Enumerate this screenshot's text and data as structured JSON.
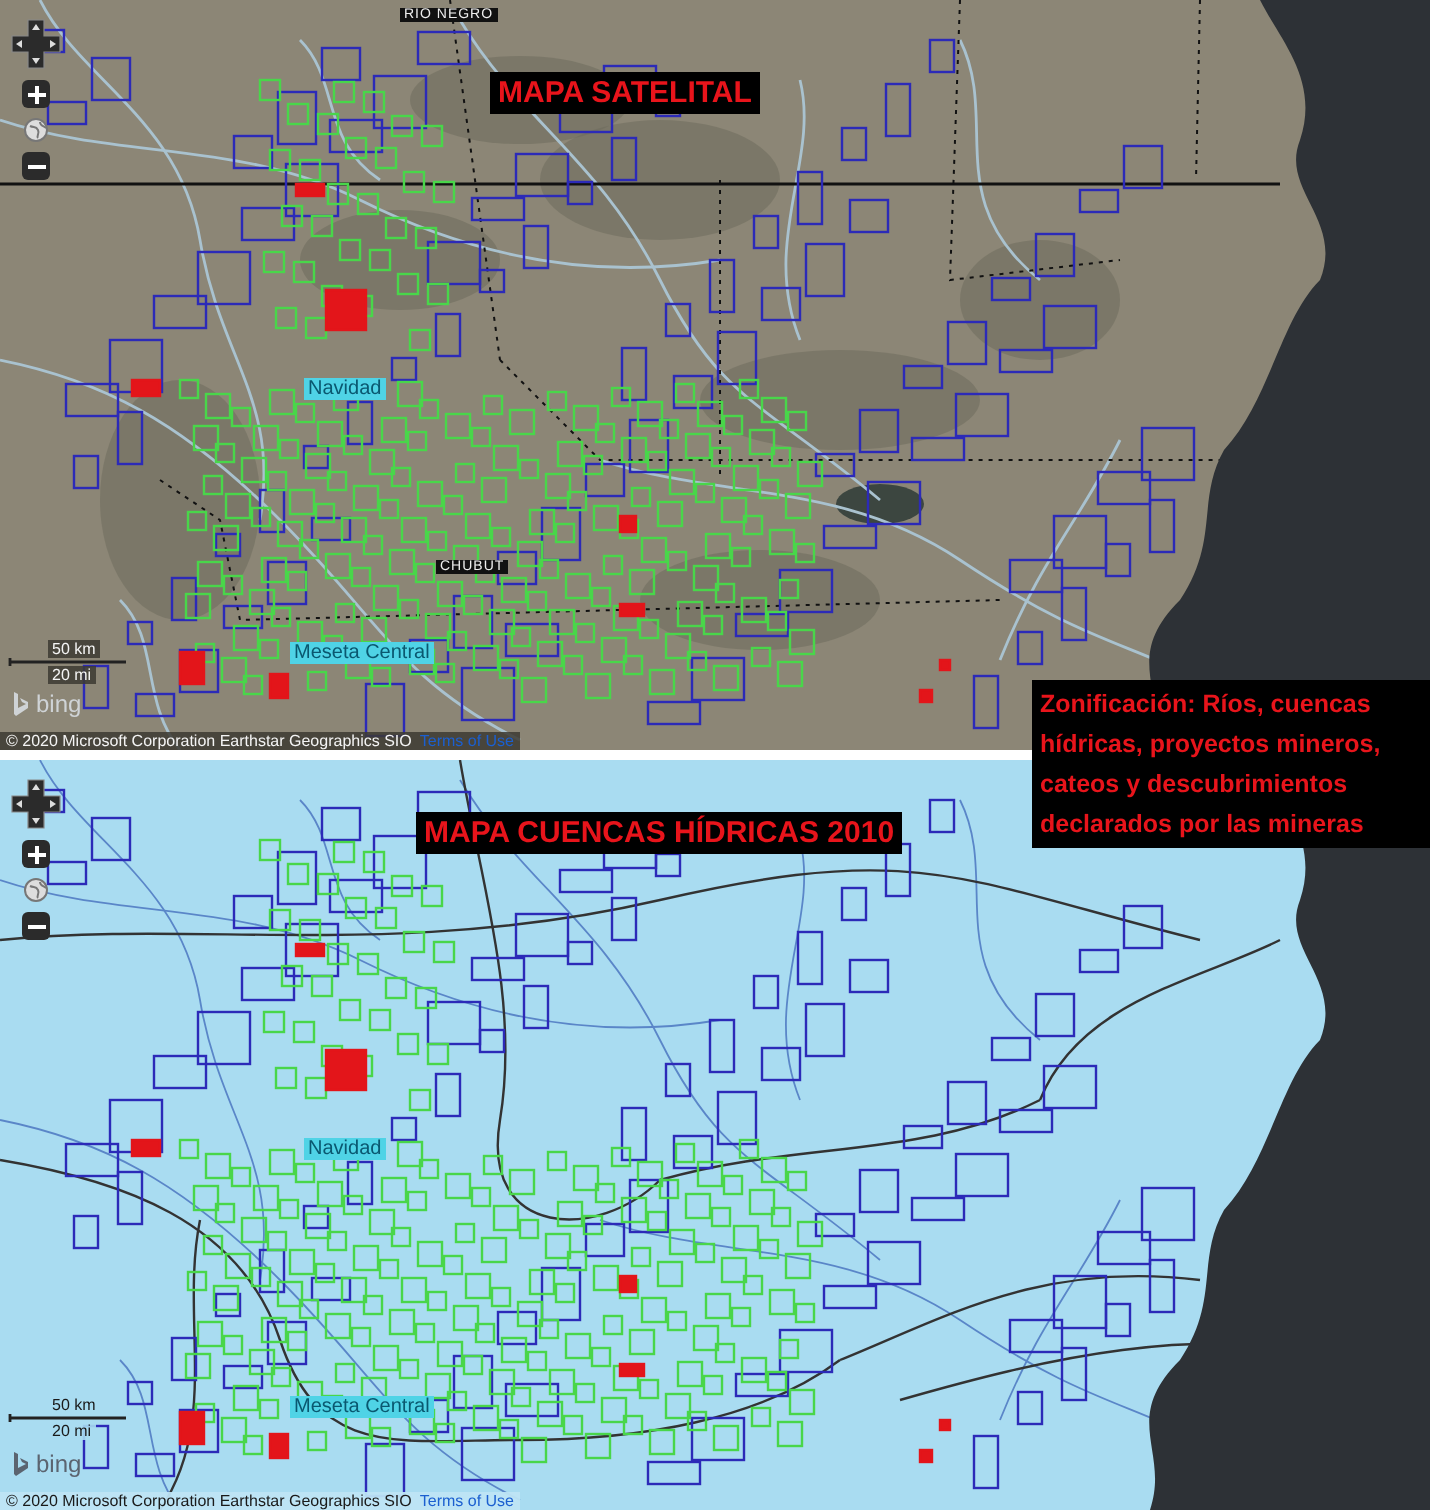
{
  "maps": [
    {
      "kind": "satellite",
      "title": "MAPA SATELITAL",
      "labels": [
        {
          "text": "RIO NEGRO",
          "kind": "region"
        },
        {
          "text": "Navidad",
          "kind": "place"
        },
        {
          "text": "CHUBUT",
          "kind": "region"
        },
        {
          "text": "Meseta Central",
          "kind": "place"
        }
      ],
      "scale": {
        "km": "50 km",
        "mi": "20 mi"
      },
      "logo": "bing",
      "attribution": "© 2020 Microsoft Corporation Earthstar Geographics SIO",
      "terms": "Terms of Use"
    },
    {
      "kind": "hydro",
      "title": "MAPA CUENCAS HÍDRICAS 2010",
      "labels": [
        {
          "text": "Navidad",
          "kind": "place"
        },
        {
          "text": "Meseta Central",
          "kind": "place"
        }
      ],
      "scale": {
        "km": "50 km",
        "mi": "20 mi"
      },
      "logo": "bing",
      "attribution": "© 2020 Microsoft Corporation Earthstar Geographics SIO",
      "terms": "Terms of Use"
    }
  ],
  "note": "Zonificación: Ríos, cuencas hídricas, proyectos mineros, cateos y descubrimientos declarados por las mineras"
}
